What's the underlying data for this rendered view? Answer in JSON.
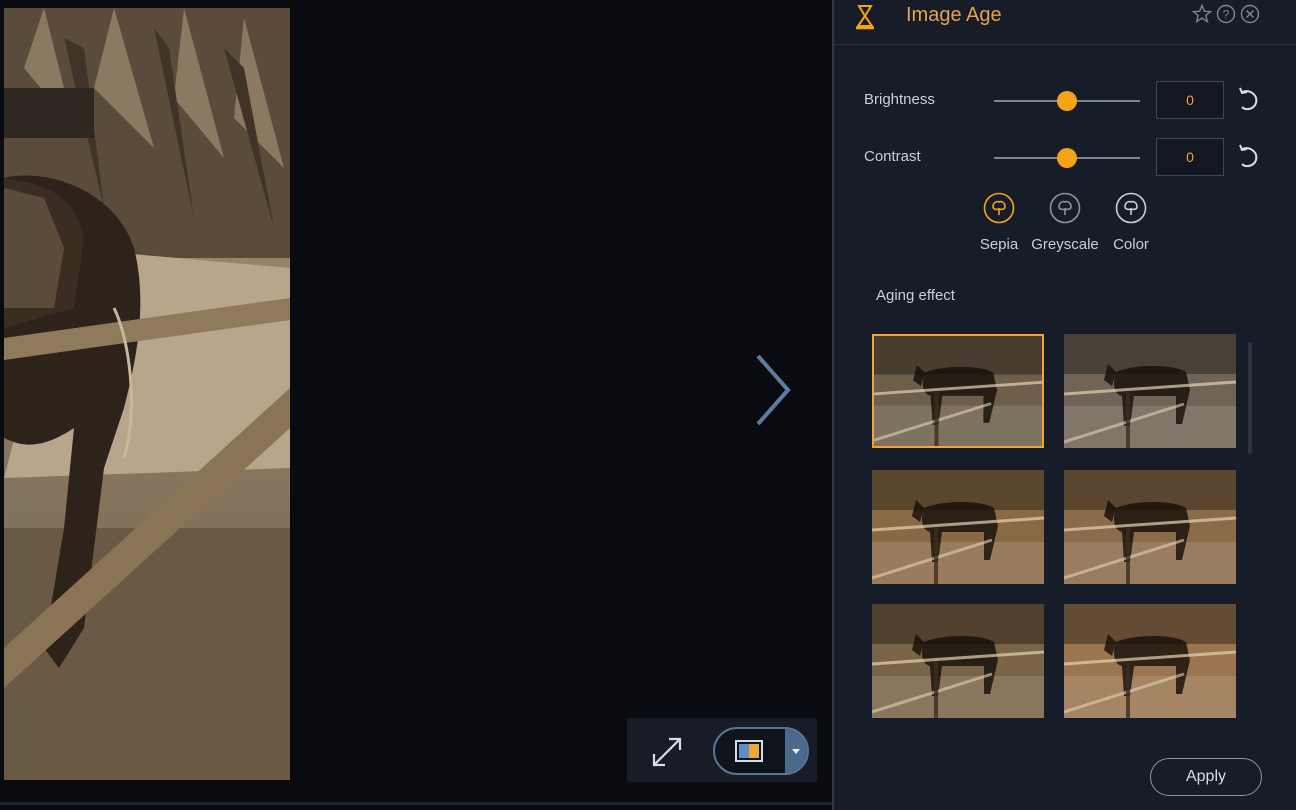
{
  "panel": {
    "title": "Image Age",
    "accent_color": "#f5a316",
    "header_icons": [
      "hourglass-icon",
      "star-icon",
      "help-icon",
      "close-icon"
    ]
  },
  "adjustments": {
    "brightness": {
      "label": "Brightness",
      "value": "0",
      "level": 0.5
    },
    "contrast": {
      "label": "Contrast",
      "value": "0",
      "level": 0.5
    }
  },
  "tones": [
    {
      "label": "Sepia",
      "selected": true
    },
    {
      "label": "Greyscale",
      "selected": false
    },
    {
      "label": "Color",
      "selected": false
    }
  ],
  "aging": {
    "label": "Aging effect",
    "presets": [
      {
        "tint": "#6d5f4c",
        "selected": true
      },
      {
        "tint": "#6f6455",
        "selected": false
      },
      {
        "tint": "#8a6a45",
        "selected": false
      },
      {
        "tint": "#8a6c4a",
        "selected": false
      },
      {
        "tint": "#7a6447",
        "selected": false
      },
      {
        "tint": "#9a7550",
        "selected": false
      }
    ]
  },
  "footer": {
    "apply_label": "Apply"
  },
  "canvas": {
    "icons": [
      "next-arrow-icon",
      "fit-to-screen-icon",
      "compare-split-icon",
      "chevron-down-icon"
    ]
  }
}
